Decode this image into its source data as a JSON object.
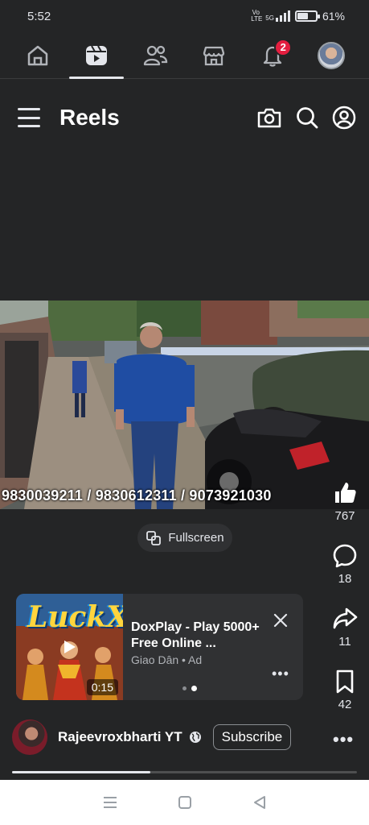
{
  "status_bar": {
    "time": "5:52",
    "network_label": "Vo LTE",
    "signal_label": "5G",
    "battery_percent_text": "61%",
    "battery_level": 0.61
  },
  "top_nav": {
    "items": [
      {
        "name": "home",
        "icon": "home-icon"
      },
      {
        "name": "reels",
        "icon": "reels-icon",
        "active": true
      },
      {
        "name": "friends",
        "icon": "friends-icon"
      },
      {
        "name": "marketplace",
        "icon": "marketplace-icon"
      },
      {
        "name": "notifications",
        "icon": "bell-icon",
        "badge": "2"
      },
      {
        "name": "profile",
        "icon": "avatar"
      }
    ]
  },
  "header": {
    "title": "Reels",
    "icons": [
      "camera-icon",
      "search-icon",
      "profile-icon"
    ]
  },
  "video": {
    "overlay_text": "9830039211 / 9830612311 / 9073921030"
  },
  "fullscreen_label": "Fullscreen",
  "actions": {
    "like_count": "767",
    "comment_count": "18",
    "share_count": "11",
    "save_count": "42"
  },
  "ad": {
    "thumb_title": "LuckX",
    "duration": "0:15",
    "title": "DoxPlay - Play 5000+ Free Online ...",
    "sponsor": "Giao Dân • Ad",
    "carousel_active_index": 1,
    "carousel_count": 2
  },
  "author": {
    "name": "Rajeevroxbharti YT",
    "subscribe_label": "Subscribe"
  },
  "playback_progress": 0.4,
  "colors": {
    "background": "#242526",
    "badge": "#e41e3f",
    "text": "#e4e6eb"
  }
}
